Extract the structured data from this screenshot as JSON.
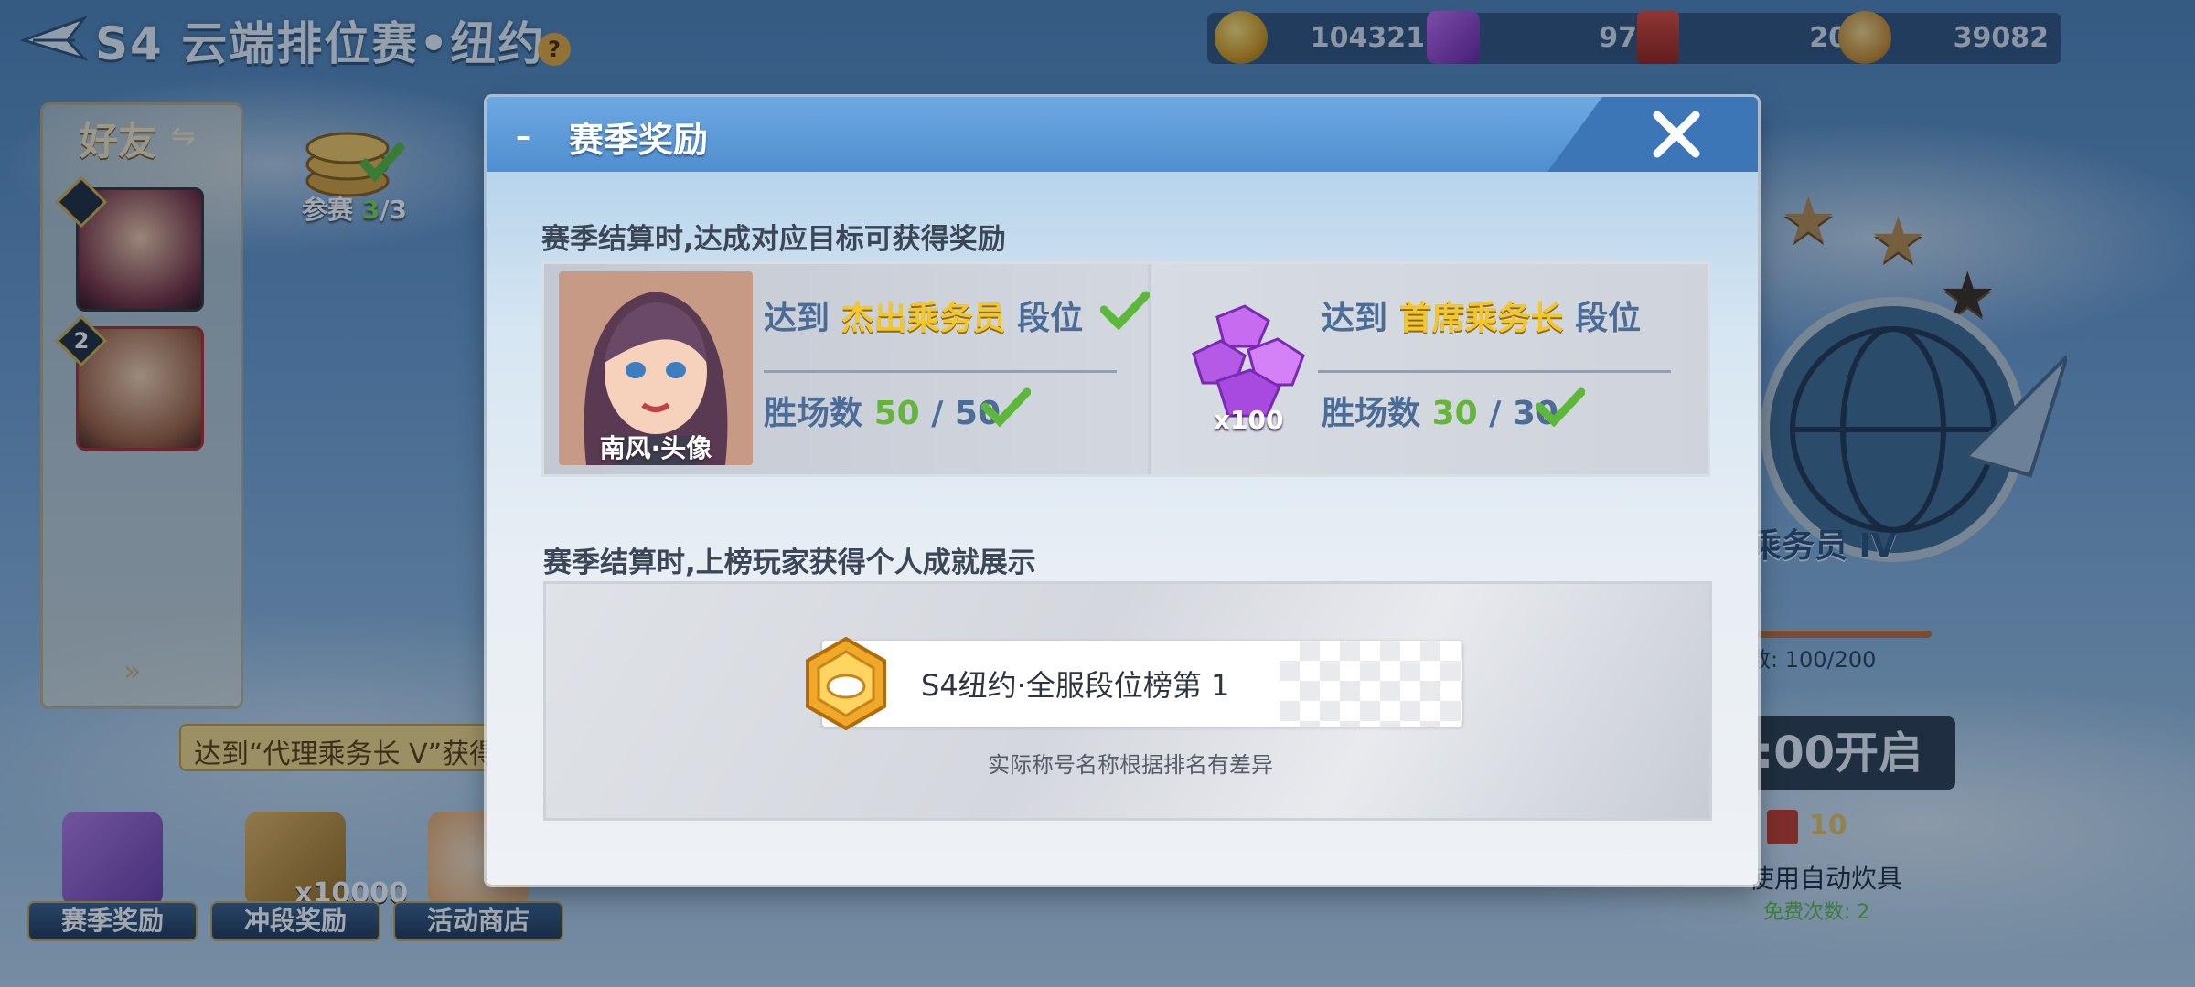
{
  "header": {
    "title": "S4 云端排位赛•纽约",
    "help_label": "?"
  },
  "currencies": [
    {
      "icon": "gold-coin-icon",
      "value": "104321"
    },
    {
      "icon": "purple-gem-icon",
      "value": "97"
    },
    {
      "icon": "red-ticket-icon",
      "value": "20"
    },
    {
      "icon": "rank-coin-icon",
      "value": "39082"
    }
  ],
  "friends": {
    "title": "好友",
    "swap_label": "⇋",
    "slots": [
      {
        "badge": ""
      },
      {
        "badge": "2"
      }
    ],
    "more_label": "»"
  },
  "entries": {
    "label": "参赛",
    "current": "3",
    "total": "/3"
  },
  "hint": {
    "text": "达到“代理乘务长  V”获得"
  },
  "bottom_buttons": [
    {
      "label": "赛季奖励",
      "qty": ""
    },
    {
      "label": "冲段奖励",
      "qty": "x10000"
    },
    {
      "label": "活动商店",
      "qty": ""
    }
  ],
  "rank": {
    "name": "乘务员  IV",
    "points": "数:    100/200",
    "open_label": ":00开启",
    "cost": "10",
    "auto_label": "使用自动炊具",
    "free_label": "免费次数: 2"
  },
  "modal": {
    "dash": "–",
    "title": "赛季奖励",
    "section1_title": "赛季结算时,达成对应目标可获得奖励",
    "reward1": {
      "caption": "南风·头像",
      "req_prefix": "达到",
      "rank": "杰出乘务员",
      "req_suffix": "段位",
      "wins_label": "胜场数",
      "wins_current": "50",
      "wins_total": "/ 50"
    },
    "reward2": {
      "qty": "x100",
      "req_prefix": "达到",
      "rank": "首席乘务长",
      "req_suffix": "段位",
      "wins_label": "胜场数",
      "wins_current": "30",
      "wins_total": "/ 30"
    },
    "section2_title": "赛季结算时,上榜玩家获得个人成就展示",
    "achievement": {
      "text": "S4纽约·全服段位榜第 1",
      "note": "实际称号名称根据排名有差异"
    }
  },
  "colors": {
    "accent_yellow": "#f3c62c",
    "win_green": "#64b53a",
    "modal_header": "#5b99d8",
    "req_blue": "#4a6c96"
  }
}
